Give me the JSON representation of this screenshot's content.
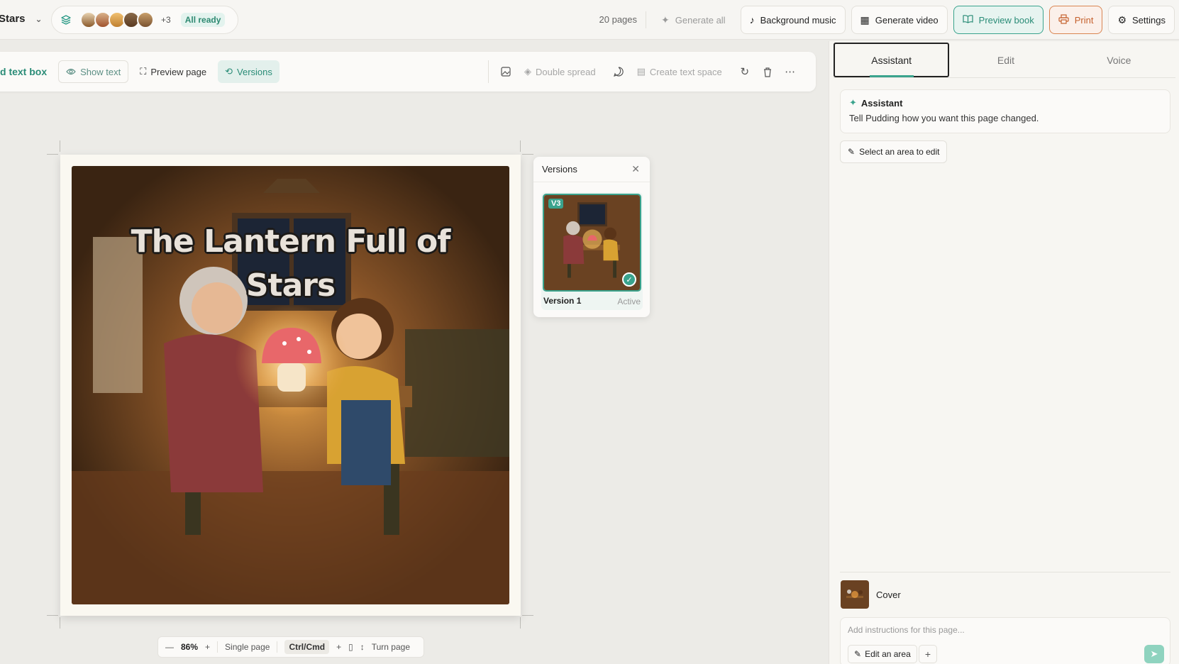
{
  "topbar": {
    "book_title": "Stars",
    "characters_more": "+3",
    "ready_status": "All ready",
    "pages_count": "20 pages",
    "generate_all": "Generate all",
    "background_music": "Background music",
    "generate_video": "Generate video",
    "preview_book": "Preview book",
    "print": "Print",
    "settings": "Settings"
  },
  "toolbar": {
    "add_text_box": "d text box",
    "show_text": "Show text",
    "preview_page": "Preview page",
    "versions": "Versions",
    "double_spread": "Double spread",
    "create_text_space": "Create text space"
  },
  "page": {
    "cover_title": "The Lantern Full of Stars"
  },
  "versions_popover": {
    "title": "Versions",
    "badge": "V3",
    "version_label": "Version 1",
    "status": "Active"
  },
  "zoom_bar": {
    "zoom": "86%",
    "mode": "Single page",
    "shortcut": "Ctrl/Cmd",
    "plus": "+",
    "turn_page": "Turn page"
  },
  "right_panel": {
    "tabs": [
      "Assistant",
      "Edit",
      "Voice"
    ],
    "assistant_title": "Assistant",
    "assistant_message": "Tell Pudding how you want this page changed.",
    "select_area": "Select an area to edit",
    "cover_label": "Cover",
    "instructions_placeholder": "Add instructions for this page...",
    "edit_area": "Edit an area"
  },
  "colors": {
    "accent": "#3aa38d",
    "print": "#c5602c"
  }
}
